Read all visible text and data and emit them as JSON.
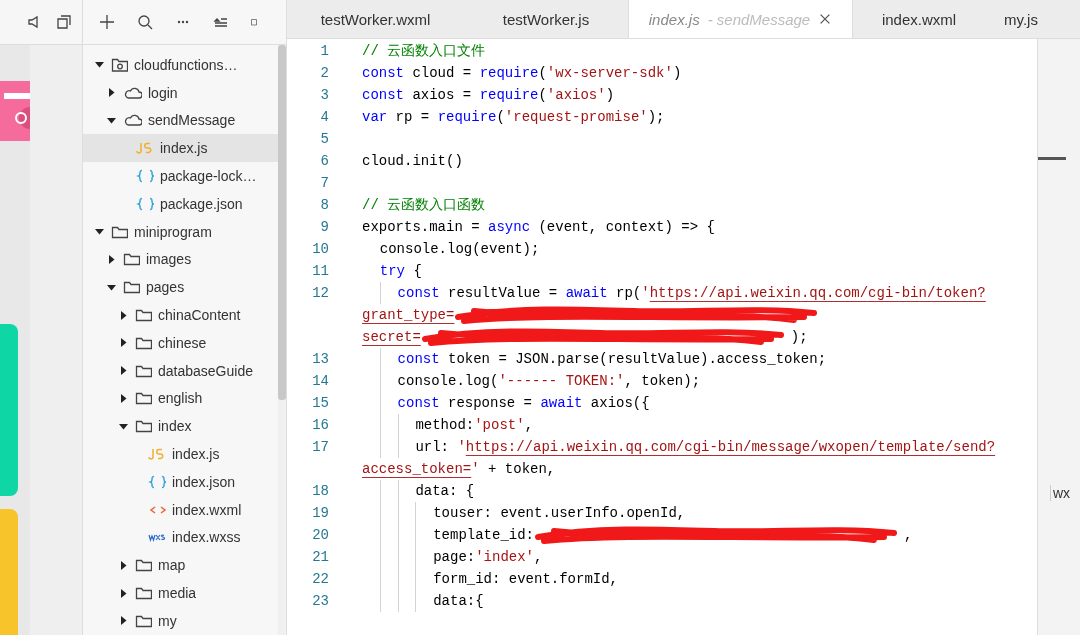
{
  "explorer": {
    "tree": [
      {
        "label": "cloudfunctions…",
        "kind": "cloud-folder",
        "expanded": true,
        "selected": false,
        "children": [
          {
            "label": "login",
            "kind": "cloud",
            "expanded": false,
            "selected": false
          },
          {
            "label": "sendMessage",
            "kind": "cloud",
            "expanded": true,
            "selected": false,
            "children": [
              {
                "label": "index.js",
                "kind": "js",
                "selected": true
              },
              {
                "label": "package-lock…",
                "kind": "json",
                "selected": false
              },
              {
                "label": "package.json",
                "kind": "json",
                "selected": false
              }
            ]
          }
        ]
      },
      {
        "label": "miniprogram",
        "kind": "folder",
        "expanded": true,
        "selected": false,
        "children": [
          {
            "label": "images",
            "kind": "folder",
            "expanded": false,
            "selected": false
          },
          {
            "label": "pages",
            "kind": "folder",
            "expanded": true,
            "selected": false,
            "children": [
              {
                "label": "chinaContent",
                "kind": "folder",
                "expanded": false,
                "selected": false
              },
              {
                "label": "chinese",
                "kind": "folder",
                "expanded": false,
                "selected": false
              },
              {
                "label": "databaseGuide",
                "kind": "folder",
                "expanded": false,
                "selected": false
              },
              {
                "label": "english",
                "kind": "folder",
                "expanded": false,
                "selected": false
              },
              {
                "label": "index",
                "kind": "folder",
                "expanded": true,
                "selected": false,
                "children": [
                  {
                    "label": "index.js",
                    "kind": "js",
                    "selected": false
                  },
                  {
                    "label": "index.json",
                    "kind": "json",
                    "selected": false
                  },
                  {
                    "label": "index.wxml",
                    "kind": "wxml",
                    "selected": false
                  },
                  {
                    "label": "index.wxss",
                    "kind": "wxss",
                    "selected": false
                  }
                ]
              },
              {
                "label": "map",
                "kind": "folder",
                "expanded": false,
                "selected": false
              },
              {
                "label": "media",
                "kind": "folder",
                "expanded": false,
                "selected": false
              },
              {
                "label": "my",
                "kind": "folder",
                "expanded": false,
                "selected": false
              }
            ]
          }
        ]
      }
    ]
  },
  "tabs": [
    {
      "label": "testWorker.wxml",
      "selected": false
    },
    {
      "label": "testWorker.js",
      "selected": false
    },
    {
      "label": "index.js",
      "detail": "- sendMessage",
      "selected": true
    },
    {
      "label": "index.wxml",
      "selected": false
    },
    {
      "label": "my.js",
      "selected": false
    }
  ],
  "side_panel": {
    "label": "wx"
  },
  "code": [
    {
      "number": "1",
      "rows": [
        {
          "tokens": [
            {
              "kind": "comment",
              "text": "// 云函数入口文件"
            }
          ]
        }
      ]
    },
    {
      "number": "2",
      "rows": [
        {
          "tokens": [
            {
              "kind": "keyword",
              "text": "const"
            },
            {
              "kind": "plain",
              "text": " cloud = "
            },
            {
              "kind": "keyword",
              "text": "require"
            },
            {
              "kind": "plain",
              "text": "("
            },
            {
              "kind": "string",
              "text": "'wx-server-sdk'"
            },
            {
              "kind": "plain",
              "text": ")"
            }
          ]
        }
      ]
    },
    {
      "number": "3",
      "rows": [
        {
          "tokens": [
            {
              "kind": "keyword",
              "text": "const"
            },
            {
              "kind": "plain",
              "text": " axios = "
            },
            {
              "kind": "keyword",
              "text": "require"
            },
            {
              "kind": "plain",
              "text": "("
            },
            {
              "kind": "string",
              "text": "'axios'"
            },
            {
              "kind": "plain",
              "text": ")"
            }
          ]
        }
      ]
    },
    {
      "number": "4",
      "rows": [
        {
          "tokens": [
            {
              "kind": "keyword",
              "text": "var"
            },
            {
              "kind": "plain",
              "text": " rp = "
            },
            {
              "kind": "keyword",
              "text": "require"
            },
            {
              "kind": "plain",
              "text": "("
            },
            {
              "kind": "string",
              "text": "'request-promise'"
            },
            {
              "kind": "plain",
              "text": ");"
            }
          ]
        }
      ]
    },
    {
      "number": "5"
    },
    {
      "number": "6",
      "rows": [
        {
          "tokens": [
            {
              "kind": "plain",
              "text": "cloud.init()"
            }
          ]
        }
      ]
    },
    {
      "number": "7"
    },
    {
      "number": "8",
      "rows": [
        {
          "tokens": [
            {
              "kind": "comment",
              "text": "// 云函数入口函数"
            }
          ]
        }
      ]
    },
    {
      "number": "9",
      "rows": [
        {
          "tokens": [
            {
              "kind": "plain",
              "text": "exports.main = "
            },
            {
              "kind": "keyword",
              "text": "async"
            },
            {
              "kind": "plain",
              "text": " (event, context) => {"
            }
          ]
        }
      ]
    },
    {
      "number": "10",
      "rows": [
        {
          "tokens": [
            {
              "kind": "plain",
              "text": "  console.log(event);"
            }
          ]
        }
      ]
    },
    {
      "number": "11",
      "rows": [
        {
          "tokens": [
            {
              "kind": "keyword",
              "text": "  try"
            },
            {
              "kind": "plain",
              "text": " {"
            }
          ]
        }
      ]
    },
    {
      "number": "12",
      "rows": [
        {
          "tokens": [
            {
              "kind": "keyword",
              "text": "    const"
            },
            {
              "kind": "plain",
              "text": " resultValue = "
            },
            {
              "kind": "keyword",
              "text": "await"
            },
            {
              "kind": "plain",
              "text": " rp("
            },
            {
              "kind": "string",
              "text": "'"
            },
            {
              "kind": "url",
              "text": "https://api.weixin.qq.com/cgi-bin/token?"
            }
          ]
        },
        {
          "tokens": [
            {
              "kind": "url",
              "text": "grant_type="
            },
            {
              "kind": "redacted"
            }
          ]
        },
        {
          "tokens": [
            {
              "kind": "url",
              "text": "secret="
            },
            {
              "kind": "redacted"
            },
            {
              "kind": "plain",
              "text": ");"
            }
          ]
        }
      ]
    },
    {
      "number": "13",
      "rows": [
        {
          "tokens": [
            {
              "kind": "keyword",
              "text": "    const"
            },
            {
              "kind": "plain",
              "text": " token = JSON.parse(resultValue).access_token;"
            }
          ]
        }
      ]
    },
    {
      "number": "14",
      "rows": [
        {
          "tokens": [
            {
              "kind": "plain",
              "text": "    console.log("
            },
            {
              "kind": "string",
              "text": "'------ TOKEN:'"
            },
            {
              "kind": "plain",
              "text": ", token);"
            }
          ]
        }
      ]
    },
    {
      "number": "15",
      "rows": [
        {
          "tokens": [
            {
              "kind": "keyword",
              "text": "    const"
            },
            {
              "kind": "plain",
              "text": " response = "
            },
            {
              "kind": "keyword",
              "text": "await"
            },
            {
              "kind": "plain",
              "text": " axios({"
            }
          ]
        }
      ]
    },
    {
      "number": "16",
      "rows": [
        {
          "tokens": [
            {
              "kind": "plain",
              "text": "      method:"
            },
            {
              "kind": "string",
              "text": "'post'"
            },
            {
              "kind": "plain",
              "text": ","
            }
          ]
        }
      ]
    },
    {
      "number": "17",
      "rows": [
        {
          "tokens": [
            {
              "kind": "plain",
              "text": "      url: "
            },
            {
              "kind": "string",
              "text": "'"
            },
            {
              "kind": "url",
              "text": "https://api.weixin.qq.com/cgi-bin/message/wxopen/template/send?"
            }
          ]
        },
        {
          "tokens": [
            {
              "kind": "url",
              "text": "access_token="
            },
            {
              "kind": "string",
              "text": "'"
            },
            {
              "kind": "plain",
              "text": " + token,"
            }
          ]
        }
      ]
    },
    {
      "number": "18",
      "rows": [
        {
          "tokens": [
            {
              "kind": "plain",
              "text": "      data: {"
            }
          ]
        }
      ]
    },
    {
      "number": "19",
      "rows": [
        {
          "tokens": [
            {
              "kind": "plain",
              "text": "        touser: event.userInfo.openId,"
            }
          ]
        }
      ]
    },
    {
      "number": "20",
      "rows": [
        {
          "tokens": [
            {
              "kind": "plain",
              "text": "        template_id:"
            },
            {
              "kind": "redacted"
            },
            {
              "kind": "plain",
              "text": ","
            }
          ]
        }
      ]
    },
    {
      "number": "21",
      "rows": [
        {
          "tokens": [
            {
              "kind": "plain",
              "text": "        page:"
            },
            {
              "kind": "string",
              "text": "'index'"
            },
            {
              "kind": "plain",
              "text": ","
            }
          ]
        }
      ]
    },
    {
      "number": "22",
      "rows": [
        {
          "tokens": [
            {
              "kind": "plain",
              "text": "        form_id: event.formId,"
            }
          ]
        }
      ]
    },
    {
      "number": "23",
      "rows": [
        {
          "tokens": [
            {
              "kind": "plain",
              "text": "        data:{"
            }
          ]
        }
      ]
    }
  ]
}
